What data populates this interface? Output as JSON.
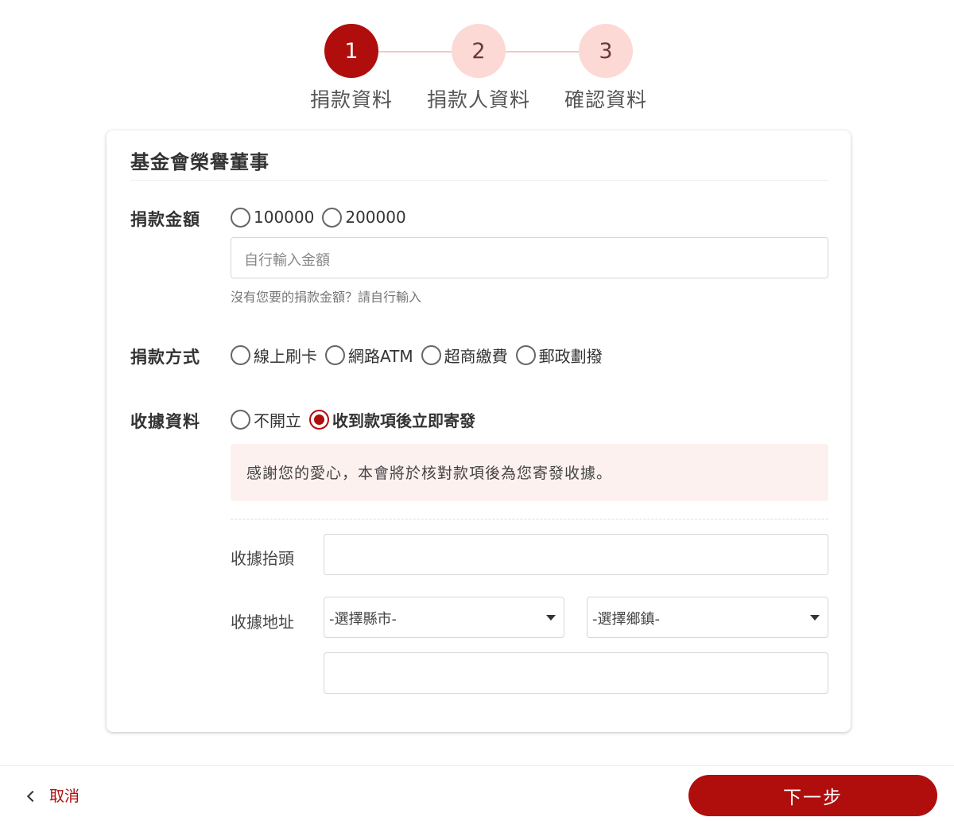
{
  "stepper": {
    "steps": [
      {
        "number": "1",
        "label": "捐款資料",
        "state": "active"
      },
      {
        "number": "2",
        "label": "捐款人資料",
        "state": "inactive"
      },
      {
        "number": "3",
        "label": "確認資料",
        "state": "inactive"
      }
    ]
  },
  "card": {
    "title": "基金會榮譽董事",
    "amount": {
      "label": "捐款金額",
      "options": [
        "100000",
        "200000"
      ],
      "custom_placeholder": "自行輸入金額",
      "hint": "沒有您要的捐款金額？請自行輸入"
    },
    "method": {
      "label": "捐款方式",
      "options": [
        "線上刷卡",
        "網路ATM",
        "超商繳費",
        "郵政劃撥"
      ]
    },
    "receipt": {
      "label": "收據資料",
      "options": [
        "不開立",
        "收到款項後立即寄發"
      ],
      "selected": "收到款項後立即寄發",
      "notice": "感謝您的愛心，本會將於核對款項後為您寄發收據。",
      "header_label": "收據抬頭",
      "header_value": "",
      "address_label": "收據地址",
      "city_select": "-選擇縣市-",
      "town_select": "-選擇鄉鎮-",
      "address_value": ""
    }
  },
  "footer": {
    "cancel_label": "取消",
    "next_label": "下一步"
  },
  "colors": {
    "primary": "#b00d0d",
    "step_inactive": "#fcd9d5",
    "notice_bg": "#fdf1f0"
  }
}
